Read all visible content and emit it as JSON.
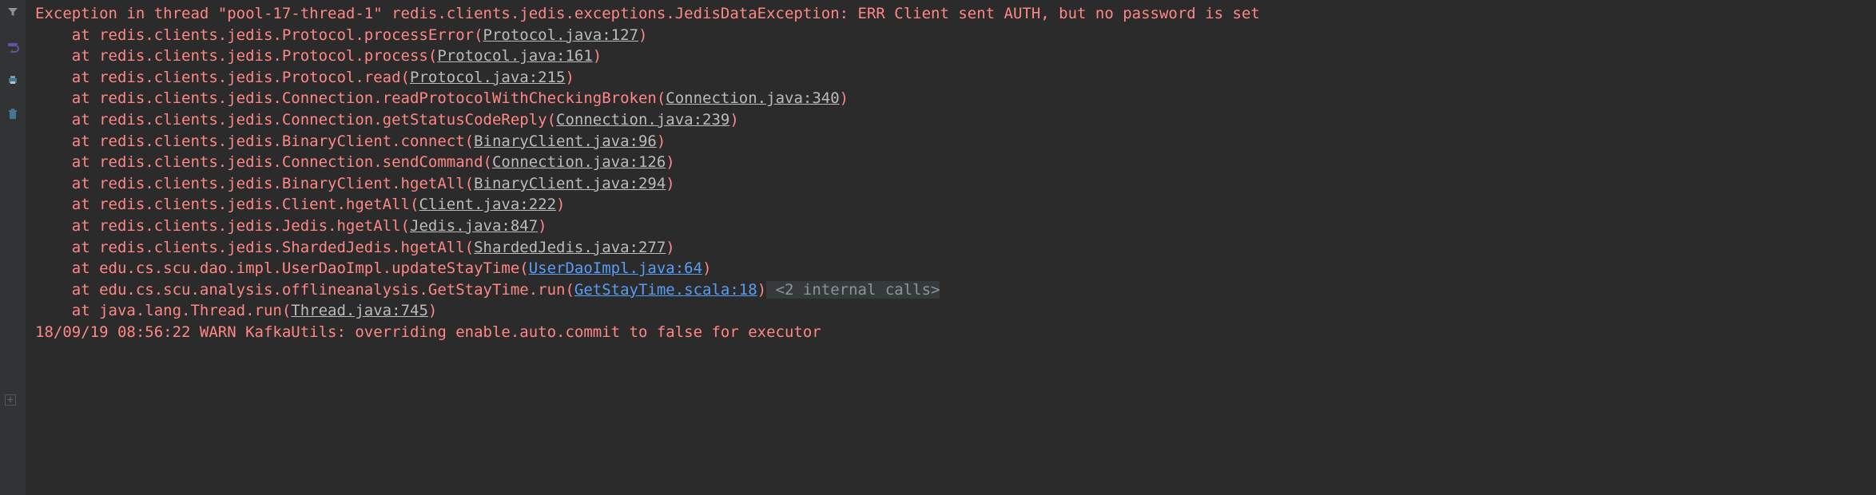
{
  "gutter": {
    "icons": [
      "filter-icon",
      "wrap-icon",
      "print-icon",
      "clear-icon"
    ]
  },
  "exception": {
    "header": "Exception in thread \"pool-17-thread-1\" redis.clients.jedis.exceptions.JedisDataException: ERR Client sent AUTH, but no password is set",
    "frames": [
      {
        "pre": "at redis.clients.jedis.Protocol.processError(",
        "link": "Protocol.java:127",
        "suf": ")",
        "cls": "link"
      },
      {
        "pre": "at redis.clients.jedis.Protocol.process(",
        "link": "Protocol.java:161",
        "suf": ")",
        "cls": "link"
      },
      {
        "pre": "at redis.clients.jedis.Protocol.read(",
        "link": "Protocol.java:215",
        "suf": ")",
        "cls": "link"
      },
      {
        "pre": "at redis.clients.jedis.Connection.readProtocolWithCheckingBroken(",
        "link": "Connection.java:340",
        "suf": ")",
        "cls": "link"
      },
      {
        "pre": "at redis.clients.jedis.Connection.getStatusCodeReply(",
        "link": "Connection.java:239",
        "suf": ")",
        "cls": "link"
      },
      {
        "pre": "at redis.clients.jedis.BinaryClient.connect(",
        "link": "BinaryClient.java:96",
        "suf": ")",
        "cls": "link"
      },
      {
        "pre": "at redis.clients.jedis.Connection.sendCommand(",
        "link": "Connection.java:126",
        "suf": ")",
        "cls": "link"
      },
      {
        "pre": "at redis.clients.jedis.BinaryClient.hgetAll(",
        "link": "BinaryClient.java:294",
        "suf": ")",
        "cls": "link"
      },
      {
        "pre": "at redis.clients.jedis.Client.hgetAll(",
        "link": "Client.java:222",
        "suf": ")",
        "cls": "link"
      },
      {
        "pre": "at redis.clients.jedis.Jedis.hgetAll(",
        "link": "Jedis.java:847",
        "suf": ")",
        "cls": "link"
      },
      {
        "pre": "at redis.clients.jedis.ShardedJedis.hgetAll(",
        "link": "ShardedJedis.java:277",
        "suf": ")",
        "cls": "link"
      },
      {
        "pre": "at edu.cs.scu.dao.impl.UserDaoImpl.updateStayTime(",
        "link": "UserDaoImpl.java:64",
        "suf": ")",
        "cls": "link-blue"
      },
      {
        "pre": "at edu.cs.scu.analysis.offlineanalysis.GetStayTime.run(",
        "link": "GetStayTime.scala:18",
        "suf": ")",
        "cls": "link-blue",
        "info": " <2 internal calls>"
      },
      {
        "pre": "at java.lang.Thread.run(",
        "link": "Thread.java:745",
        "suf": ")",
        "cls": "link"
      }
    ],
    "footer": "18/09/19 08:56:22 WARN KafkaUtils: overriding enable.auto.commit to false for executor"
  },
  "expand_marker": "+"
}
